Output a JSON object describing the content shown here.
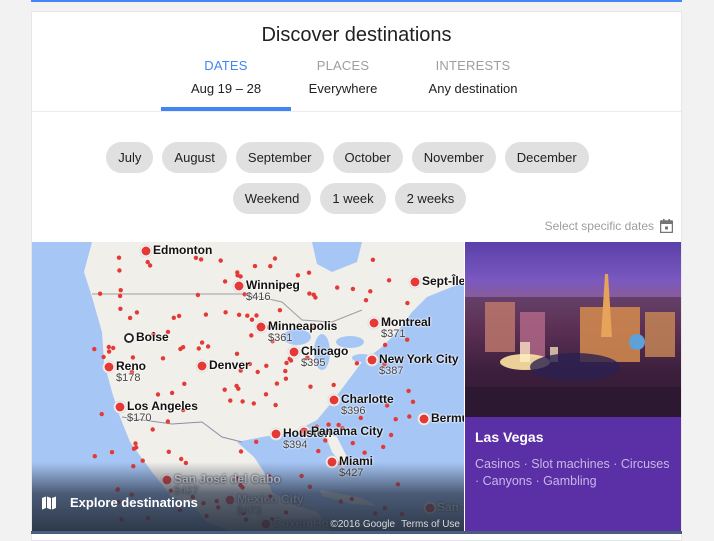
{
  "header": {
    "title": "Discover destinations"
  },
  "tabs": [
    {
      "label": "DATES",
      "value": "Aug 19 – 28",
      "active": true
    },
    {
      "label": "PLACES",
      "value": "Everywhere",
      "active": false
    },
    {
      "label": "INTERESTS",
      "value": "Any destination",
      "active": false
    }
  ],
  "month_chips": [
    "July",
    "August",
    "September",
    "October",
    "November",
    "December"
  ],
  "duration_chips": [
    "Weekend",
    "1 week",
    "2 weeks"
  ],
  "select_dates": {
    "label": "Select specific dates",
    "icon": "calendar-icon"
  },
  "map": {
    "explore_label": "Explore destinations",
    "explore_icon": "map-icon",
    "copyright": "©2016 Google",
    "terms": "Terms of Use",
    "origin": "Boise",
    "cities": [
      {
        "name": "Edmonton",
        "price": ""
      },
      {
        "name": "Winnipeg",
        "price": "$416"
      },
      {
        "name": "Sept-Îles",
        "price": ""
      },
      {
        "name": "Minneapolis",
        "price": "$361"
      },
      {
        "name": "Montreal",
        "price": "$371"
      },
      {
        "name": "Chicago",
        "price": "$395"
      },
      {
        "name": "New York City",
        "price": "$387"
      },
      {
        "name": "Reno",
        "price": "$178"
      },
      {
        "name": "Denver",
        "price": ""
      },
      {
        "name": "Los Angeles",
        "price": "$170"
      },
      {
        "name": "Charlotte",
        "price": "$396"
      },
      {
        "name": "Bermuda",
        "price": ""
      },
      {
        "name": "Houston",
        "price": "$394"
      },
      {
        "name": "Panama City",
        "price": ""
      },
      {
        "name": "Miami",
        "price": "$427"
      },
      {
        "name": "San José del Cabo",
        "price": "$427"
      },
      {
        "name": "Mexico City",
        "price": "$473"
      },
      {
        "name": "Coxen Hole",
        "price": ""
      },
      {
        "name": "San Juan",
        "price": ""
      }
    ]
  },
  "featured": {
    "name": "Las Vegas",
    "tags": "Casinos · Slot machines · Circuses · Canyons · Gambling",
    "color": "#5b2fa6"
  },
  "colors": {
    "accent": "#4285f4",
    "chip": "#e0e0e0",
    "dot": "#e53935"
  }
}
